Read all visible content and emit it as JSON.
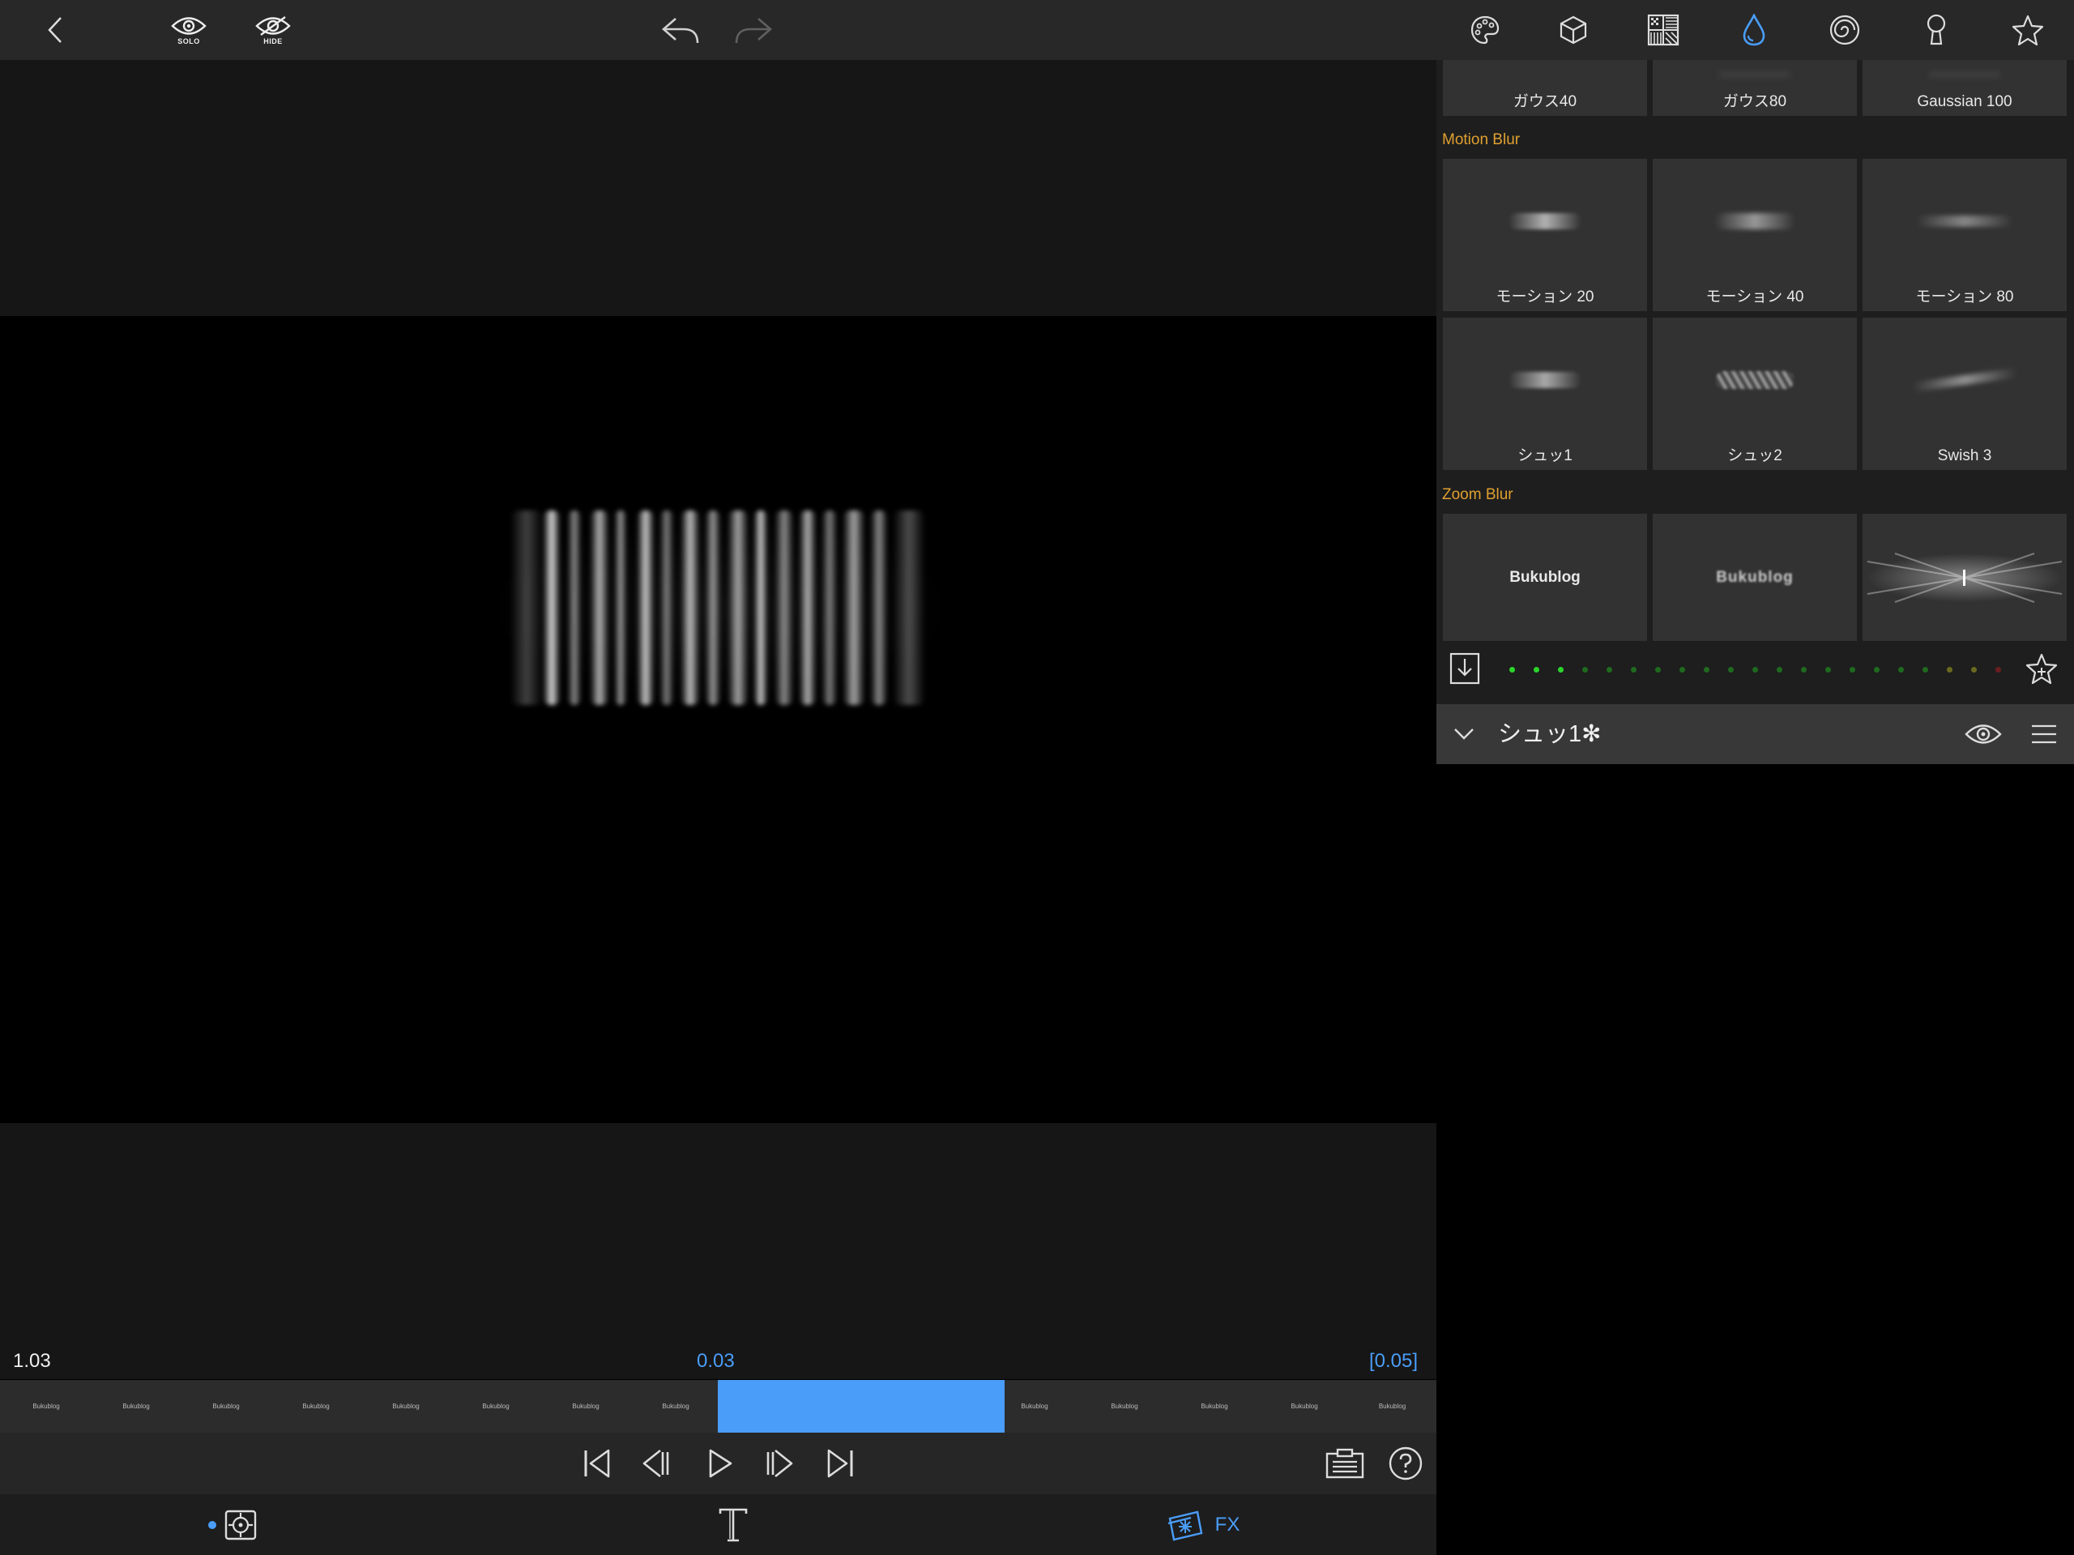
{
  "topbar": {
    "solo_label": "SOLO",
    "hide_label": "HIDE",
    "active_color": "#4a9df8",
    "tabs": [
      "palette-icon",
      "cube-icon",
      "pattern-icon",
      "drop-icon",
      "spiral-icon",
      "keyhole-icon",
      "star-icon"
    ]
  },
  "timeline": {
    "left_time": "1.03",
    "center_time": "0.03",
    "right_time": "[0.05]",
    "thumb_text": "Bukublog"
  },
  "bottombar": {
    "fx_label": "FX"
  },
  "presets": {
    "gaussian_row": [
      "ガウス40",
      "ガウス80",
      "Gaussian 100"
    ],
    "motion_blur_header": "Motion Blur",
    "motion_row1": [
      "モーション 20",
      "モーション 40",
      "モーション 80"
    ],
    "motion_row2": [
      "シュッ1",
      "シュッ2",
      "Swish 3"
    ],
    "zoom_blur_header": "Zoom Blur",
    "zoom_sample_text": "Bukublog",
    "zoom_sample_text2": "Bukublog"
  },
  "fx_layer": {
    "name": "シュッ1✻"
  }
}
